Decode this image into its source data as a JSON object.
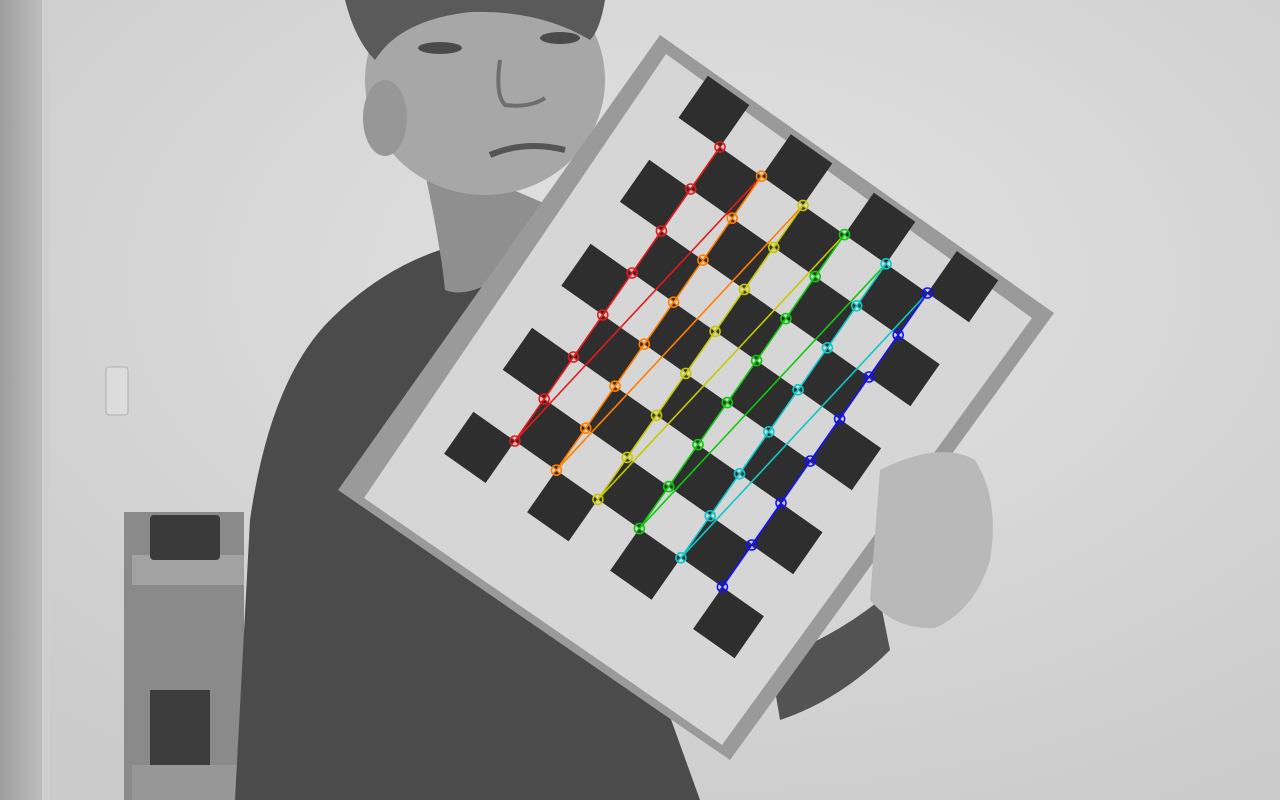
{
  "scene": {
    "subject": "person-holding-checkerboard",
    "grayscale_background": true
  },
  "detection": {
    "pattern": "checkerboard",
    "inner_corners": {
      "cols": 8,
      "rows": 6
    },
    "row_colors": [
      "#e31a1c",
      "#ff7f00",
      "#c8c800",
      "#10c810",
      "#10c8c8",
      "#1010ff"
    ]
  }
}
